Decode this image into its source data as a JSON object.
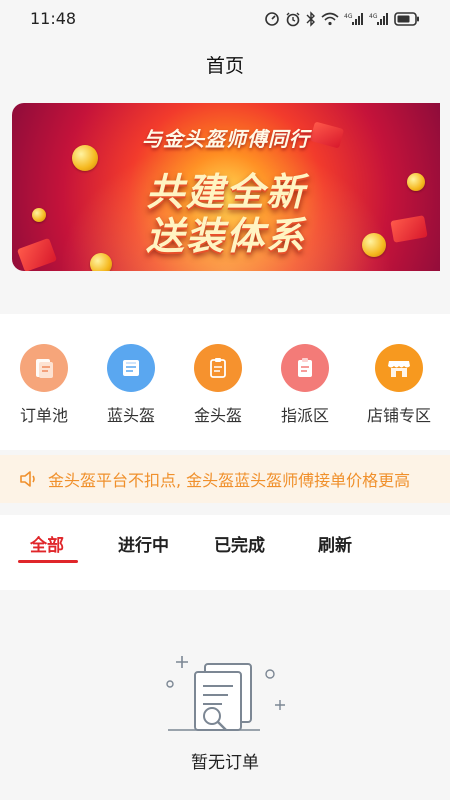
{
  "status_bar": {
    "time": "11:48",
    "icons": [
      "data-saver-icon",
      "alarm-icon",
      "bluetooth-icon",
      "wifi-icon",
      "signal-4g-icon",
      "signal-4g-icon",
      "battery-icon"
    ],
    "signal_label_1": "4G",
    "signal_label_2": "4G"
  },
  "header": {
    "title": "首页"
  },
  "banner": {
    "subtitle": "与金头盔师傅同行",
    "line1": "共建全新",
    "line2": "送装体系"
  },
  "shortcuts": [
    {
      "label": "订单池",
      "icon": "order-pool-icon",
      "color": "#f6a57a"
    },
    {
      "label": "蓝头盔",
      "icon": "blue-helmet-icon",
      "color": "#5aa7f0"
    },
    {
      "label": "金头盔",
      "icon": "gold-helmet-icon",
      "color": "#f6922e"
    },
    {
      "label": "指派区",
      "icon": "assign-area-icon",
      "color": "#f37b78"
    },
    {
      "label": "店铺专区",
      "icon": "shop-icon",
      "color": "#f7991f"
    }
  ],
  "notice": {
    "icon": "speaker-icon",
    "text": "金头盔平台不扣点, 金头盔蓝头盔师傅接单价格更高"
  },
  "tabs": [
    {
      "label": "全部",
      "active": true
    },
    {
      "label": "进行中",
      "active": false
    },
    {
      "label": "已完成",
      "active": false
    },
    {
      "label": "刷新",
      "active": false
    }
  ],
  "empty_state": {
    "icon": "empty-orders-icon",
    "text": "暂无订单"
  },
  "colors": {
    "accent": "#e0262a",
    "notice_text": "#f0902c",
    "notice_bg": "#fdf3e6"
  }
}
